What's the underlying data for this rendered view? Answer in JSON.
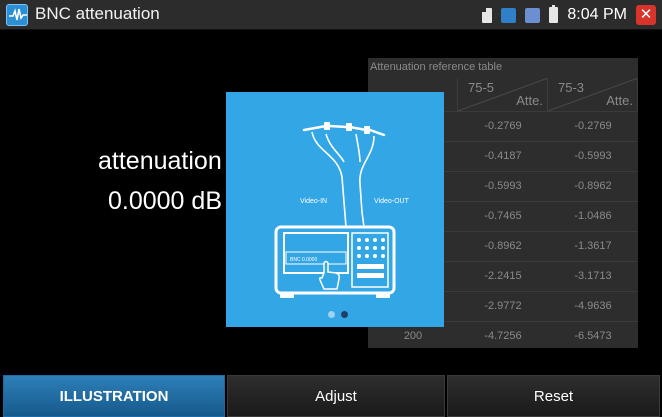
{
  "window": {
    "title": "BNC attenuation"
  },
  "status_bar": {
    "time": "8:04 PM",
    "close_glyph": "✕"
  },
  "reading": {
    "label": "attenuation",
    "value": "0.0000 dB"
  },
  "reference_table": {
    "title": "Attenuation reference table",
    "columns": [
      {
        "top": "",
        "bottom": ""
      },
      {
        "top": "75-5",
        "bottom": "Atte."
      },
      {
        "top": "75-3",
        "bottom": "Atte."
      }
    ],
    "rows": [
      [
        "",
        "-0.2769",
        "-0.2769"
      ],
      [
        "",
        "-0.4187",
        "-0.5993"
      ],
      [
        "",
        "-0.5993",
        "-0.8962"
      ],
      [
        "",
        "-0.7465",
        "-1.0486"
      ],
      [
        "",
        "-0.8962",
        "-1.3617"
      ],
      [
        "",
        "-2.2415",
        "-3.1713"
      ],
      [
        "",
        "-2.9772",
        "-4.9636"
      ],
      [
        "200",
        "-4.7256",
        "-6.5473"
      ]
    ]
  },
  "illustration": {
    "video_in_label": "Video-IN",
    "video_out_label": "Video-OUT",
    "device_screen_text": "BNC  0.0000",
    "page_count": 2,
    "active_page": 2
  },
  "buttons": {
    "illustration": "ILLUSTRATION",
    "adjust": "Adjust",
    "reset": "Reset"
  },
  "colors": {
    "popup_bg": "#33a6e6",
    "active_button": "#1f6fa8",
    "close_button": "#d9342b"
  }
}
